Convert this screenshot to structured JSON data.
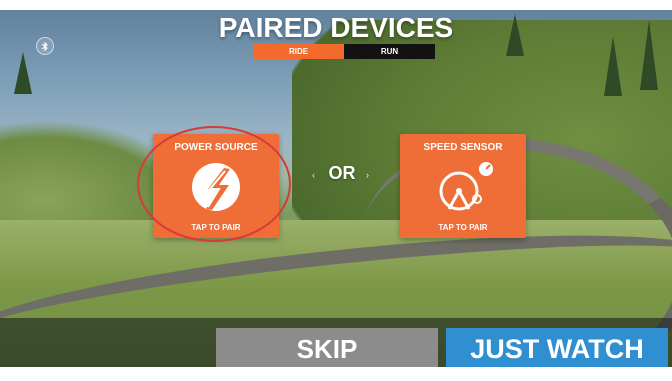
{
  "header": {
    "title": "PAIRED DEVICES",
    "tabs": [
      {
        "label": "RIDE",
        "active": true
      },
      {
        "label": "RUN",
        "active": false
      }
    ]
  },
  "status": {
    "bluetooth_icon": "bluetooth-icon"
  },
  "cards": {
    "power": {
      "title": "POWER SOURCE",
      "footer": "TAP TO PAIR",
      "icon": "power-bolt-icon"
    },
    "speed": {
      "title": "SPEED SENSOR",
      "footer": "TAP TO PAIR",
      "icon": "speed-sensor-icon"
    }
  },
  "divider": {
    "or_label": "OR"
  },
  "actions": {
    "skip_label": "SKIP",
    "just_watch_label": "JUST WATCH"
  },
  "colors": {
    "accent_orange": "#ef6e37",
    "tab_active": "#f26b2d",
    "tab_inactive": "#121212",
    "skip_button": "#8c8c8c",
    "watch_button": "#2f8fd0",
    "highlight_ring": "#d83a3a"
  }
}
